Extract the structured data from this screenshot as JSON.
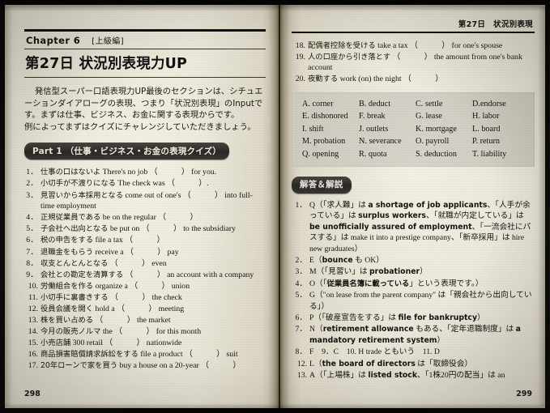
{
  "book": {
    "left_page_number": "298",
    "right_page_number": "299",
    "running_head": "第27日　状況別表現"
  },
  "chapter": {
    "label": "Chapter 6",
    "level": "[上級編]",
    "day_title": "第27日 状況別表現力UP"
  },
  "intro": {
    "line1": "発信型スーパー口語表現力UP最後のセクションは、シチュエ",
    "line2": "ーションダイアローグの表現、つまり「状況別表現」のInputで",
    "line3": "す。まずは仕事、ビジネス、お金に関する表現からです。",
    "line4": "例によってまずはクイズにチャレンジしていただきましょう。"
  },
  "part1": {
    "heading": "Part 1 （仕事・ビジネス・お金の表現クイズ）",
    "items": [
      {
        "num": "1．",
        "jp": "仕事の口はないよ",
        "en": "There's no job （　　　） for you."
      },
      {
        "num": "2．",
        "jp": "小切手が不渡りになる",
        "en": "The check was （　　　）."
      },
      {
        "num": "3．",
        "jp": "見習いから本採用となる",
        "en": "come out of one's （　　　） into full-time employment"
      },
      {
        "num": "4．",
        "jp": "正規従業員である",
        "en": "be on the regular （　　　）"
      },
      {
        "num": "5．",
        "jp": "子会社へ出向となる",
        "en": "be put on （　　　） to the subsidiary"
      },
      {
        "num": "6．",
        "jp": "税の申告をする",
        "en": "file a tax （　　　）"
      },
      {
        "num": "7．",
        "jp": "退職金をもらう",
        "en": "receive a （　　　） pay"
      },
      {
        "num": "8．",
        "jp": "収支とんとんとなる",
        "en": "（　　　） even"
      },
      {
        "num": "9．",
        "jp": "会社との勘定を清算する",
        "en": "（　　　） an account with a company"
      },
      {
        "num": "10.",
        "jp": "労働組合を作る",
        "en": "organize a （　　　） union"
      },
      {
        "num": "11.",
        "jp": "小切手に裏書きする",
        "en": "（　　　） the check"
      },
      {
        "num": "12.",
        "jp": "役員会議を開く",
        "en": "hold a （　　　） meeting"
      },
      {
        "num": "13.",
        "jp": "株を買い占める",
        "en": "（　　　） the market"
      },
      {
        "num": "14.",
        "jp": "今月の販売ノルマ",
        "en": "the （　　　） for this month"
      },
      {
        "num": "15.",
        "jp": "小売店舗",
        "en": "300 retail （　　　） nationwide"
      },
      {
        "num": "16.",
        "jp": "商品損害賠償請求訴訟をする",
        "en": "file a product （　　　） suit"
      },
      {
        "num": "17.",
        "jp": "20年ローンで家を買う",
        "en": "buy a house on a 20-year （　　　）"
      },
      {
        "num": "18.",
        "jp": "配偶者控除を受ける",
        "en": "take a tax （　　　） for one's spouse"
      },
      {
        "num": "19.",
        "jp": "人の口座から引き落とす",
        "en": "（　　　） the amount from one's bank account"
      },
      {
        "num": "20.",
        "jp": "夜勤する",
        "en": "work (on) the night （　　　）"
      }
    ]
  },
  "options": [
    "A. corner",
    "B. deduct",
    "C. settle",
    "D.endorse",
    "E. dishonored",
    "F. break",
    "G. lease",
    "H. labor",
    "I. shift",
    "J. outlets",
    "K. mortgage",
    "L. board",
    "M. probation",
    "N. severance",
    "O. payroll",
    "P. return",
    "Q. opening",
    "R. quota",
    "S. deduction",
    "T. liability"
  ],
  "answers": {
    "heading": "解答＆解説",
    "items": [
      {
        "num": "1．",
        "parts": [
          {
            "t": "Q（「求人難」は ",
            "style": "serif"
          },
          {
            "t": "a shortage of job applicants",
            "style": "gothic"
          },
          {
            "t": "、「人手が余っている」は ",
            "style": "serif"
          },
          {
            "t": "surplus workers",
            "style": "gothic"
          },
          {
            "t": "、「就職が内定している」は ",
            "style": "serif"
          },
          {
            "t": "be unofficially assured of employment",
            "style": "gothic"
          },
          {
            "t": "、「一流会社にパスする」は make it into a prestige company、「新卒採用」は hire new graduates）",
            "style": "serif"
          }
        ]
      },
      {
        "num": "2．",
        "parts": [
          {
            "t": "E（",
            "style": "serif"
          },
          {
            "t": "bounce",
            "style": "gothic"
          },
          {
            "t": " も OK）",
            "style": "serif"
          }
        ]
      },
      {
        "num": "3．",
        "parts": [
          {
            "t": "M（「見習い」は ",
            "style": "serif"
          },
          {
            "t": "probationer",
            "style": "gothic"
          },
          {
            "t": "）",
            "style": "serif"
          }
        ]
      },
      {
        "num": "4．",
        "parts": [
          {
            "t": "O（「",
            "style": "serif"
          },
          {
            "t": "従業員名簿に載っている",
            "style": "gothic"
          },
          {
            "t": "」という表現です。）",
            "style": "serif"
          }
        ]
      },
      {
        "num": "5．",
        "parts": [
          {
            "t": "G（\"on lease from the parent company\" は「親会社から出向している」）",
            "style": "serif"
          }
        ]
      },
      {
        "num": "6．",
        "parts": [
          {
            "t": "P（「破産宣告をする」は ",
            "style": "serif"
          },
          {
            "t": "file for bankruptcy",
            "style": "gothic"
          },
          {
            "t": "）",
            "style": "serif"
          }
        ]
      },
      {
        "num": "7．",
        "parts": [
          {
            "t": "N（",
            "style": "serif"
          },
          {
            "t": "retirement allowance",
            "style": "gothic"
          },
          {
            "t": " もある、「定年退職制度」は ",
            "style": "serif"
          },
          {
            "t": "a mandatory retirement system",
            "style": "gothic"
          },
          {
            "t": "）",
            "style": "serif"
          }
        ]
      },
      {
        "num": "8．",
        "parts": [
          {
            "t": "F　9．C　10. H trade ともいう　11. D",
            "style": "serif"
          }
        ]
      },
      {
        "num": "12.",
        "parts": [
          {
            "t": "L（",
            "style": "serif"
          },
          {
            "t": "the board of directors",
            "style": "gothic"
          },
          {
            "t": " は「取締役会）",
            "style": "serif"
          }
        ]
      },
      {
        "num": "13.",
        "parts": [
          {
            "t": "A（「上場株」は ",
            "style": "serif"
          },
          {
            "t": "listed stock",
            "style": "gothic"
          },
          {
            "t": "、「1株20円の配当」は an",
            "style": "serif"
          }
        ]
      }
    ]
  }
}
